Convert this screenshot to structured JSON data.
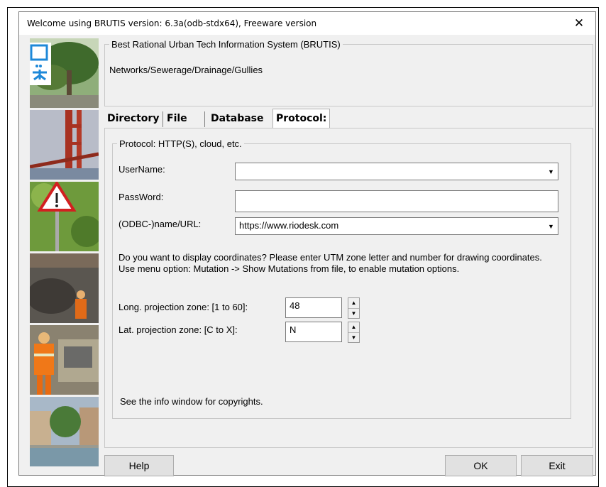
{
  "window": {
    "title": "Welcome using BRUTIS version: 6.3a(odb-stdx64), Freeware version",
    "close_glyph": "✕"
  },
  "header": {
    "legend": "Best Rational Urban Tech Information System (BRUTIS)",
    "subtitle": "Networks/Sewerage/Drainage/Gullies"
  },
  "tabs": [
    {
      "label": "Directory"
    },
    {
      "label": "File"
    },
    {
      "label": "Database"
    },
    {
      "label": "Protocol: HTTP(S), cloud, etc.",
      "active": true
    }
  ],
  "protocol": {
    "legend": "Protocol: HTTP(S), cloud, etc.",
    "username_label": "UserName:",
    "username_value": "",
    "password_label": "PassWord:",
    "password_value": "",
    "url_label": "(ODBC-)name/URL:",
    "url_value": "https://www.riodesk.com",
    "info_line1": "Do you want to display coordinates?  Please enter UTM zone letter and number for drawing coordinates.",
    "info_line2": "Use menu option: Mutation -> Show Mutations from file, to enable mutation options.",
    "long_label": "Long. projection zone: [1 to 60]:",
    "long_value": "48",
    "lat_label": "Lat. projection zone: [C to X]:",
    "lat_value": "N",
    "copyright": "See the info window for copyrights."
  },
  "buttons": {
    "help": "Help",
    "ok": "OK",
    "exit": "Exit"
  },
  "icons": {
    "dropdown": "▼",
    "spin_up": "▲",
    "spin_down": "▼"
  }
}
